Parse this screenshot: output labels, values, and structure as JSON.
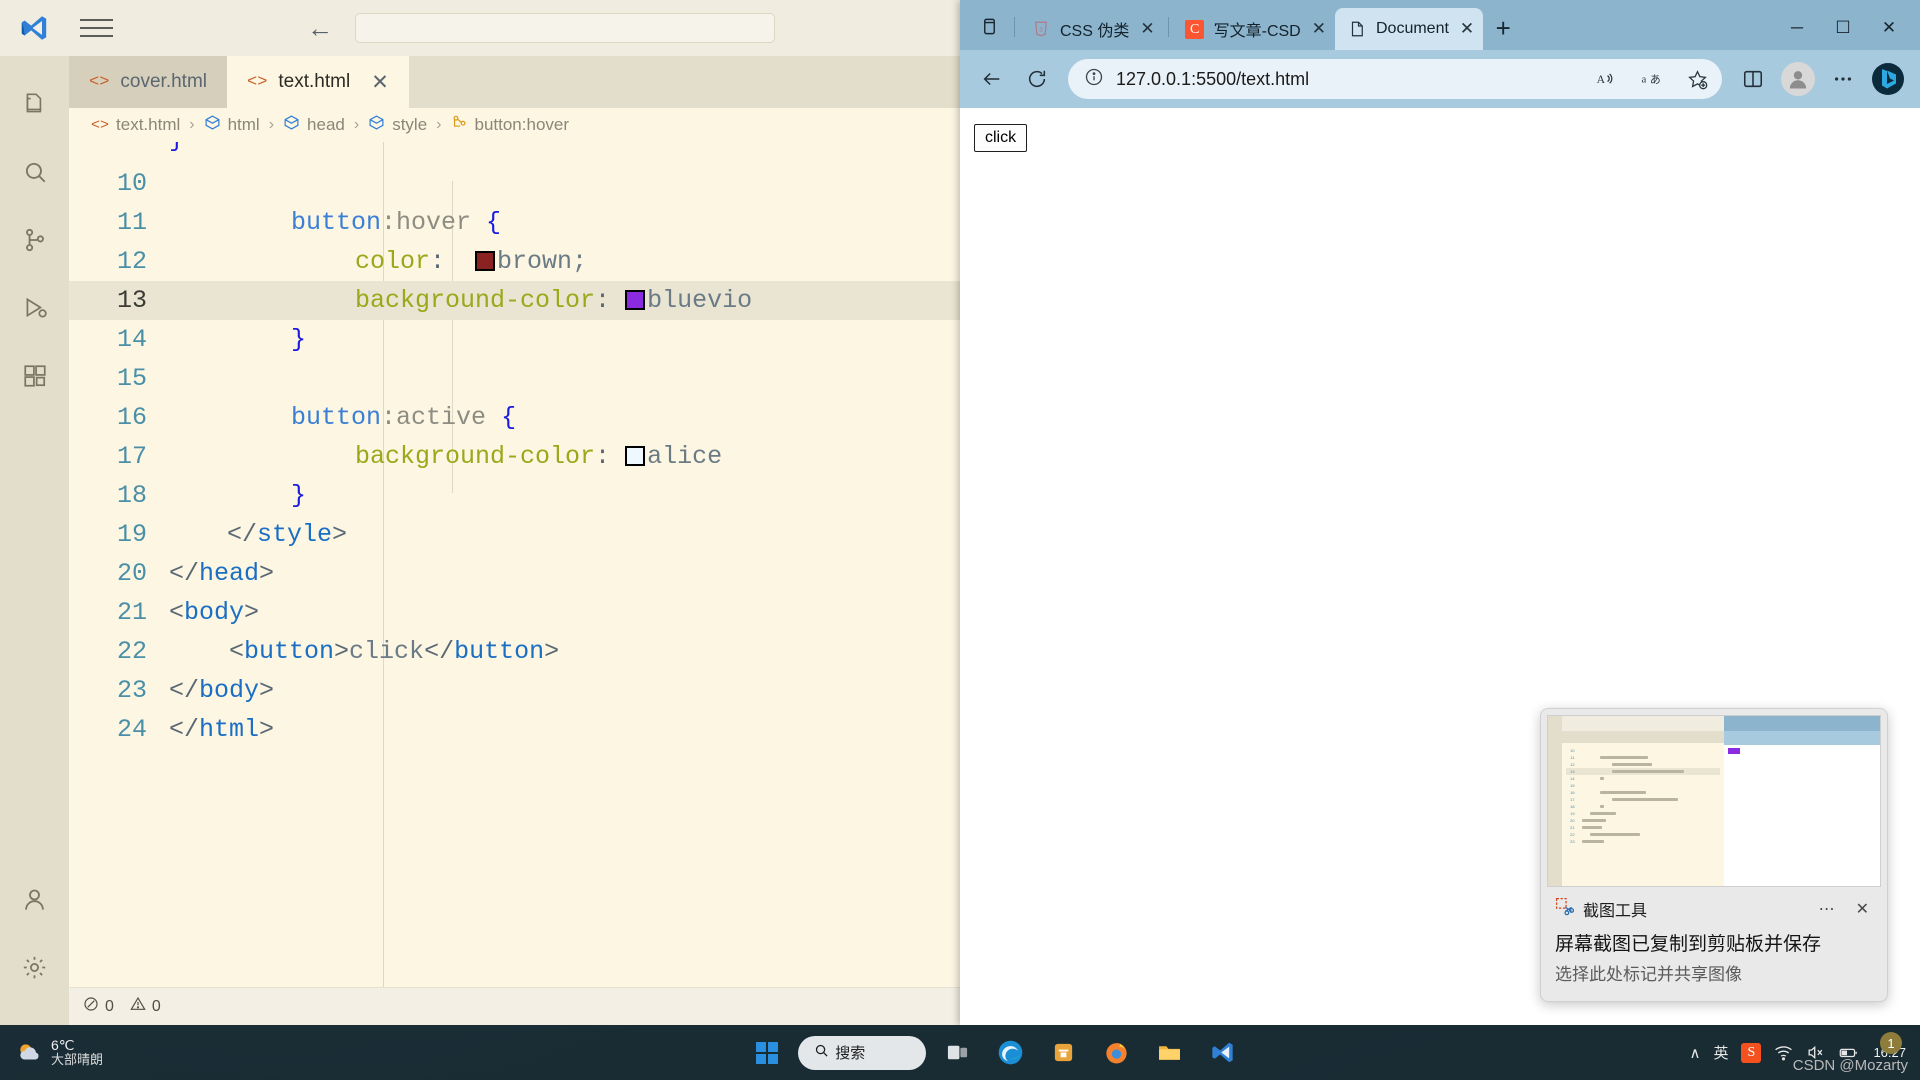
{
  "vscode": {
    "window_name": "Visual Studio Code",
    "logo_icon": "vscode-logo-icon",
    "menu_icon": "hamburger-menu-icon",
    "nav_back_icon": "arrow-left-icon",
    "command_center_placeholder": "",
    "activity_bar": [
      {
        "name": "explorer",
        "icon": "files-icon"
      },
      {
        "name": "search",
        "icon": "search-icon"
      },
      {
        "name": "source-control",
        "icon": "source-control-icon"
      },
      {
        "name": "run-and-debug",
        "icon": "run-debug-icon"
      },
      {
        "name": "extensions",
        "icon": "extensions-icon"
      },
      {
        "name": "accounts",
        "icon": "account-icon"
      },
      {
        "name": "settings",
        "icon": "gear-icon"
      }
    ],
    "tabs": [
      {
        "label": "cover.html",
        "icon": "html-file-icon",
        "active": false,
        "closable": false
      },
      {
        "label": "text.html",
        "icon": "html-file-icon",
        "active": true,
        "closable": true
      }
    ],
    "tab_close_glyph": "✕",
    "breadcrumb": [
      {
        "label": "text.html",
        "icon": "html-file-icon"
      },
      {
        "label": "html",
        "icon": "symbol-cube-icon"
      },
      {
        "label": "head",
        "icon": "symbol-cube-icon"
      },
      {
        "label": "style",
        "icon": "symbol-cube-icon"
      },
      {
        "label": "button:hover",
        "icon": "css-rule-icon"
      }
    ],
    "breadcrumb_separator": "›",
    "code": {
      "language": "html",
      "first_visible_partial_line": "}",
      "highlighted_line": 13,
      "lines": [
        {
          "num": 10,
          "text": ""
        },
        {
          "num": 11,
          "text": "    button:hover {"
        },
        {
          "num": 12,
          "text": "        color:  brown;"
        },
        {
          "num": 13,
          "text": "        background-color: bluevio"
        },
        {
          "num": 14,
          "text": "    }"
        },
        {
          "num": 15,
          "text": ""
        },
        {
          "num": 16,
          "text": "    button:active {"
        },
        {
          "num": 17,
          "text": "        background-color:  alice"
        },
        {
          "num": 18,
          "text": "    }"
        },
        {
          "num": 19,
          "text": "  </style>"
        },
        {
          "num": 20,
          "text": "</head>"
        },
        {
          "num": 21,
          "text": "<body>"
        },
        {
          "num": 22,
          "text": "   <button>click</button>"
        },
        {
          "num": 23,
          "text": "</body>"
        },
        {
          "num": 24,
          "text": "</html>"
        }
      ],
      "color_swatches": {
        "brown": "#8b2222",
        "blueviolet": "#8a2be2",
        "aliceblue": "#f0f8ff"
      }
    },
    "status_bar": {
      "errors_icon": "error-circle-icon",
      "errors": "0",
      "warnings_icon": "warning-triangle-icon",
      "warnings": "0"
    }
  },
  "edge": {
    "tabstrip_first_icon": "tab-actions-icon",
    "tabs": [
      {
        "title": "CSS 伪类",
        "favicon": "css3-icon",
        "active": false
      },
      {
        "title": "写文章-CSD",
        "favicon": "csdn-icon",
        "active": false
      },
      {
        "title": "Document",
        "favicon": "document-icon",
        "active": true
      }
    ],
    "tab_close_glyph": "✕",
    "new_tab_glyph": "+",
    "window_controls": {
      "minimize": "─",
      "maximize": "☐",
      "close": "✕"
    },
    "toolbar": {
      "back_icon": "arrow-left-icon",
      "refresh_icon": "refresh-icon",
      "site_info_icon": "info-circle-icon",
      "url": "127.0.0.1:5500/text.html",
      "read_aloud_icon": "read-aloud-icon",
      "translate_icon": "translate-icon",
      "favorite_icon": "add-favorite-star-icon",
      "split_screen_icon": "split-screen-icon",
      "profile_icon": "profile-avatar-icon",
      "settings_more_icon": "more-options-icon",
      "copilot_icon": "copilot-bing-icon"
    },
    "page": {
      "button_label": "click"
    }
  },
  "toast": {
    "app_icon": "snipping-tool-icon",
    "title": "截图工具",
    "more_glyph": "⋯",
    "close_glyph": "✕",
    "line1": "屏幕截图已复制到剪贴板并保存",
    "line2": "选择此处标记并共享图像",
    "thumbnail_alt": "screenshot-preview"
  },
  "taskbar": {
    "weather": {
      "icon": "weather-partly-sunny-icon",
      "temp": "6℃",
      "desc": "大部晴朗"
    },
    "start_icon": "windows-start-icon",
    "search_icon": "search-icon",
    "search_label": "搜索",
    "apps": [
      {
        "name": "task-view",
        "icon": "task-view-icon"
      },
      {
        "name": "microsoft-edge",
        "icon": "edge-icon"
      },
      {
        "name": "microsoft-store",
        "icon": "store-icon"
      },
      {
        "name": "firefox",
        "icon": "firefox-icon"
      },
      {
        "name": "file-explorer",
        "icon": "folder-icon"
      },
      {
        "name": "visual-studio-code",
        "icon": "vscode-icon"
      }
    ],
    "tray": {
      "overflow_glyph": "∧",
      "ime_label": "英",
      "sogou_icon": "sogou-ime-icon",
      "network_icon": "wifi-icon",
      "volume_icon": "volume-muted-icon",
      "battery_icon": "battery-icon"
    },
    "clock": {
      "time": "16:27"
    },
    "watermark": "CSDN @Mozarty",
    "notification_count": "1"
  }
}
